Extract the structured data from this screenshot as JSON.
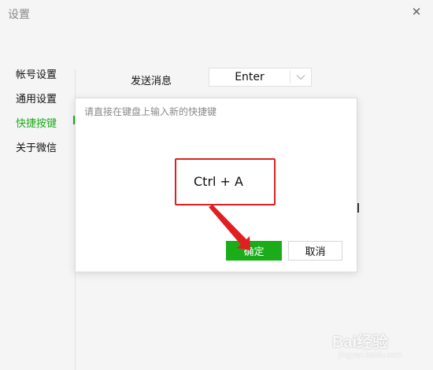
{
  "window": {
    "title": "设置"
  },
  "sidebar": {
    "items": [
      {
        "label": "帐号设置"
      },
      {
        "label": "通用设置"
      },
      {
        "label": "快捷按键"
      },
      {
        "label": "关于微信"
      }
    ],
    "active_index": 2
  },
  "settings": {
    "send_message": {
      "label": "发送消息",
      "value": "Enter"
    }
  },
  "dialog": {
    "prompt": "请直接在键盘上输入新的快捷键",
    "hotkey": "Ctrl + A",
    "confirm_label": "确定",
    "cancel_label": "取消"
  },
  "watermark": {
    "text": "Bai经验",
    "subtext": "jingyan.baidu.com"
  },
  "colors": {
    "accent_green": "#1aad19",
    "highlight_red": "#e02020",
    "window_bg": "#f5f5f5"
  },
  "icons": {
    "close": "close-icon",
    "dropdown": "chevron-down-icon"
  }
}
